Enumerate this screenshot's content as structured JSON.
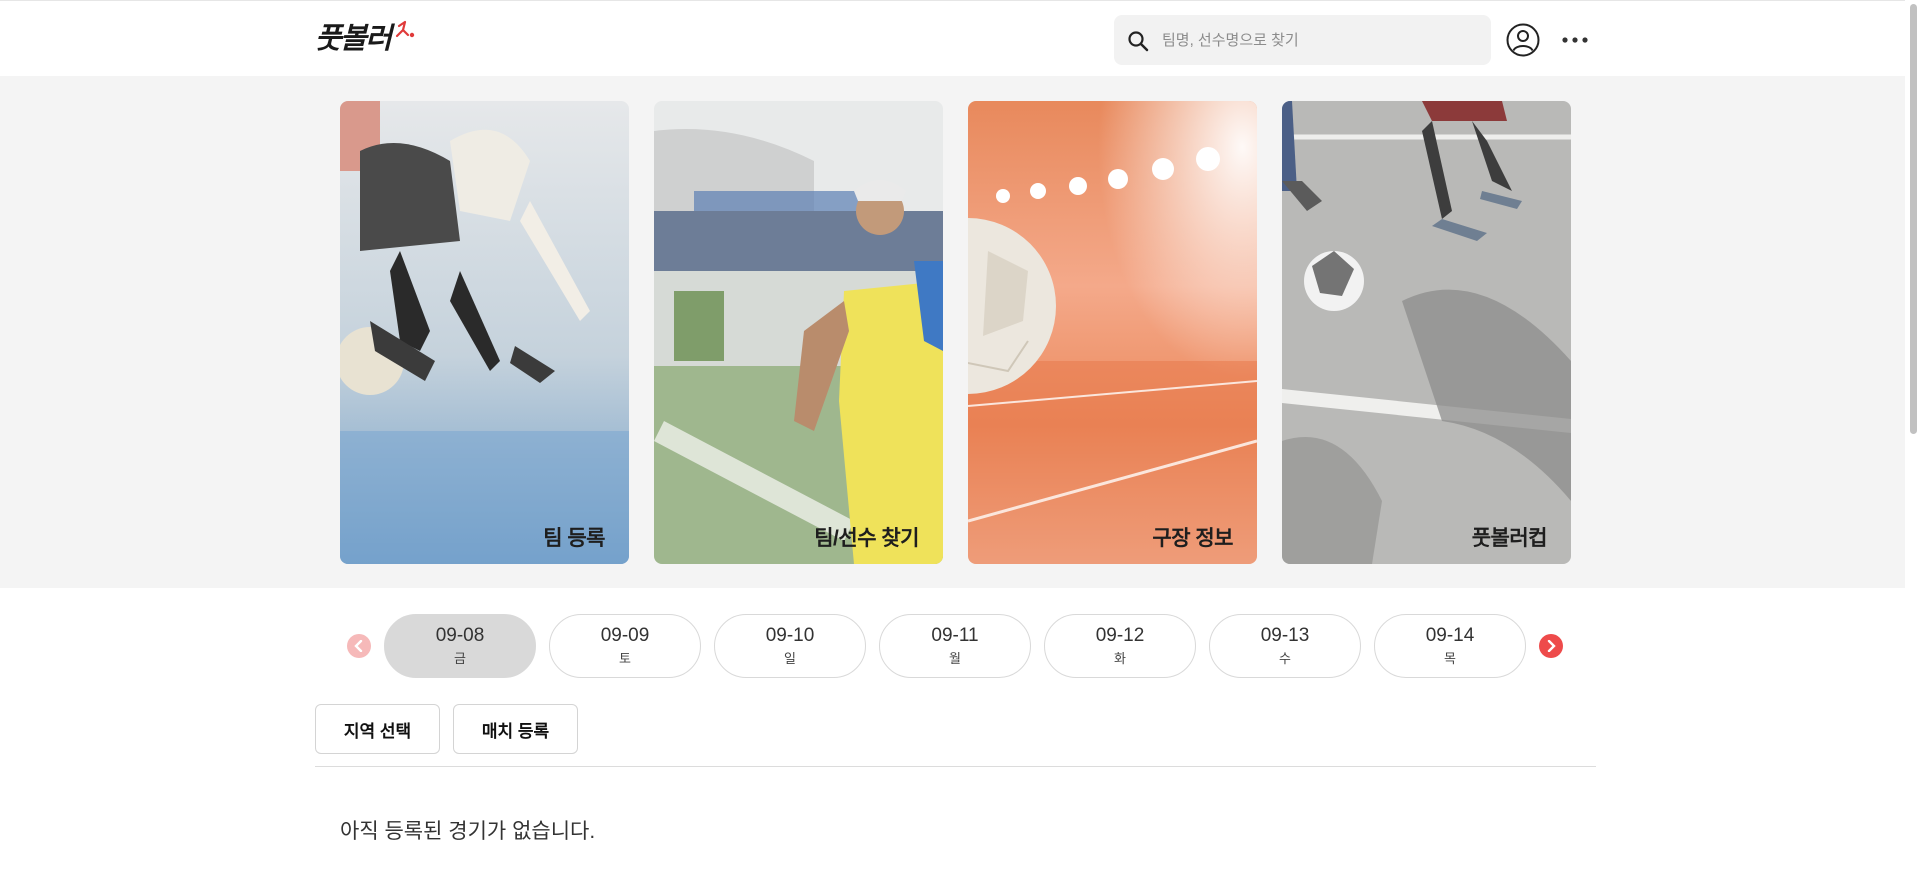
{
  "header": {
    "logo_text": "풋볼러",
    "search_placeholder": "팀명, 선수명으로 찾기"
  },
  "cards": [
    {
      "label": "팀 등록"
    },
    {
      "label": "팀/선수 찾기"
    },
    {
      "label": "구장 정보"
    },
    {
      "label": "풋볼러컵"
    }
  ],
  "dates": [
    {
      "date": "09-08",
      "weekday": "금",
      "active": true
    },
    {
      "date": "09-09",
      "weekday": "토"
    },
    {
      "date": "09-10",
      "weekday": "일"
    },
    {
      "date": "09-11",
      "weekday": "월"
    },
    {
      "date": "09-12",
      "weekday": "화"
    },
    {
      "date": "09-13",
      "weekday": "수"
    },
    {
      "date": "09-14",
      "weekday": "목"
    }
  ],
  "actions": {
    "region_label": "지역 선택",
    "match_label": "매치 등록"
  },
  "empty_message": "아직 등록된 경기가 없습니다.",
  "colors": {
    "accent": "#ee4b4b",
    "accent_light": "#f6b9b9",
    "active_pill": "#d9d9d9"
  }
}
